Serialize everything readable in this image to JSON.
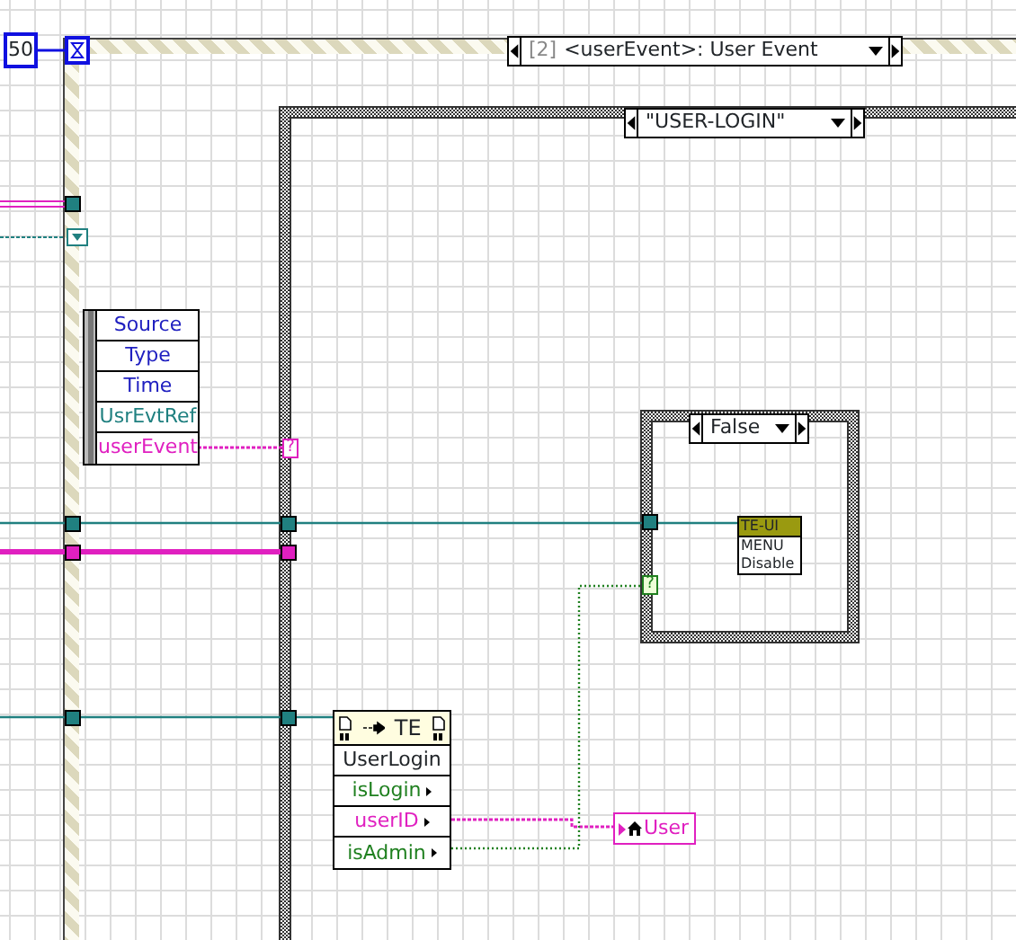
{
  "timeout_constant": "50",
  "event_structure": {
    "selector_index": "[2]",
    "selector_label": "<userEvent>: User Event"
  },
  "event_data_node": [
    {
      "label": "Source",
      "color": "#2020c0"
    },
    {
      "label": "Type",
      "color": "#2020c0"
    },
    {
      "label": "Time",
      "color": "#2020c0"
    },
    {
      "label": "UsrEvtRef",
      "color": "#208080"
    },
    {
      "label": "userEvent",
      "color": "#e020c0"
    }
  ],
  "case_structure": {
    "selector": "\"USER-LOGIN\""
  },
  "inner_case_structure": {
    "selector": "False"
  },
  "subvi": {
    "title": "TE-UI",
    "lines": [
      "MENU",
      "Disable"
    ]
  },
  "unbundle_node": {
    "title": "TE",
    "type_name": "UserLogin",
    "fields": [
      {
        "label": "isLogin",
        "color": "#208020"
      },
      {
        "label": "userID",
        "color": "#e020c0"
      },
      {
        "label": "isAdmin",
        "color": "#208020"
      }
    ]
  },
  "local_variable": {
    "label": "User"
  },
  "tunnels": [
    {
      "label": "?",
      "color": "#e020c0"
    },
    {
      "label": "?",
      "color": "#208020"
    }
  ]
}
